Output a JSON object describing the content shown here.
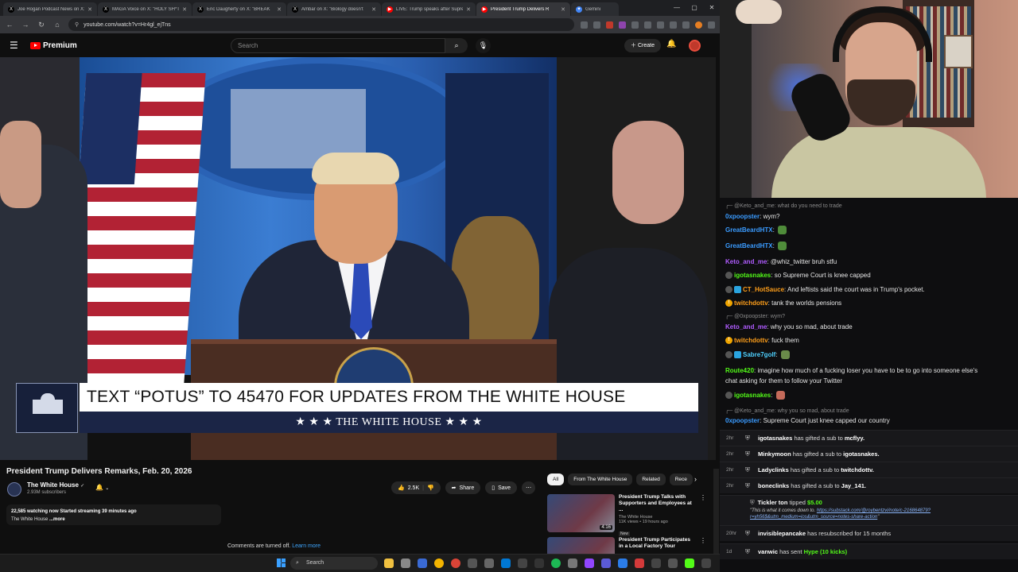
{
  "browser": {
    "tabs": [
      {
        "title": "Joe Rogan Podcast News on X:",
        "color": "#000000",
        "glyph": "X"
      },
      {
        "title": "MAGA Voice on X: \"HOLY SH*T",
        "color": "#000000",
        "glyph": "X"
      },
      {
        "title": "Eric Daugherty on X: \"BREAK",
        "color": "#000000",
        "glyph": "X"
      },
      {
        "title": "Ambar on X: \"Biology doesn't",
        "color": "#000000",
        "glyph": "X"
      },
      {
        "title": "LIVE: Trump speaks after Supre",
        "color": "#ff0000",
        "glyph": "▶"
      },
      {
        "title": "President Trump Delivers R",
        "color": "#ff0000",
        "glyph": "▶",
        "active": true
      },
      {
        "title": "Gemini",
        "color": "#4285f4",
        "glyph": "✦"
      }
    ],
    "url": "youtube.com/watch?v=Hr4gl_ejTns"
  },
  "youtube": {
    "logo_text": "Premium",
    "search_placeholder": "Search",
    "create_label": "Create",
    "video": {
      "banner_text": "TEXT “POTUS” TO 45470 FOR UPDATES FROM THE WHITE HOUSE",
      "banner_sub": "★ ★ ★  THE WHITE HOUSE  ★ ★ ★"
    },
    "title": "President Trump Delivers Remarks, Feb. 20, 2026",
    "channel": {
      "name": "The White House",
      "verified": "✓",
      "subscribers": "2.93M subscribers"
    },
    "actions": {
      "likes": "2.5K",
      "share": "Share",
      "save": "Save"
    },
    "description": {
      "line1": "22,585 watching now  Started streaming 39 minutes ago",
      "line2": "The White House",
      "more": "...more"
    },
    "comments_off": "Comments are turned off.",
    "learn_more": "Learn more",
    "chips": [
      "All",
      "From The White House",
      "Related",
      "Rece"
    ],
    "recommendations": [
      {
        "title": "President Trump Talks with Supporters and Employees at ...",
        "channel": "The White House",
        "views": "11K views • 19 hours ago",
        "badge": "New",
        "duration": "4:16"
      },
      {
        "title": "President Trump Participates in a Local Factory Tour",
        "channel": "",
        "views": "",
        "badge": "",
        "duration": ""
      }
    ]
  },
  "taskbar": {
    "search_label": "Search"
  },
  "chat": {
    "messages": [
      {
        "type": "reply",
        "text": "@Keto_and_me: what do you need to trade"
      },
      {
        "user": "0xpoopster",
        "color": "#3a9bff",
        "text": "wym?"
      },
      {
        "user": "GreatBeardHTX",
        "color": "#3a9bff",
        "text": "",
        "emote": "#4f8c3a"
      },
      {
        "user": "GreatBeardHTX",
        "color": "#3a9bff",
        "text": "",
        "emote": "#4f8c3a"
      },
      {
        "user": "Keto_and_me",
        "color": "#b05cff",
        "text": "@whiz_twitter bruh stfu"
      },
      {
        "user": "igotasnakes",
        "color": "#53fc18",
        "text": "so Supreme Court is knee capped",
        "badge": "#555"
      },
      {
        "user": "CT_HotSauce",
        "color": "#ff9f1a",
        "text": "And leftists said the court was in Trump's pocket.",
        "badge": "#555",
        "badge2": "#2aa4e0"
      },
      {
        "user": "twitchdottv",
        "color": "#ff9f1a",
        "text": "tank the worlds pensions",
        "badge": "#f0a500",
        "badgeGlyph": "!"
      },
      {
        "type": "reply",
        "text": "@0xpoopster: wym?"
      },
      {
        "user": "Keto_and_me",
        "color": "#b05cff",
        "text": "why you so mad, about trade"
      },
      {
        "user": "twitchdottv",
        "color": "#ff9f1a",
        "text": "fuck them",
        "badge": "#f0a500",
        "badgeGlyph": "!"
      },
      {
        "user": "Sabre7golf",
        "color": "#4fd1ff",
        "text": "",
        "badge": "#555",
        "badge2": "#2aa4e0",
        "emote": "#6a8a4a"
      },
      {
        "user": "Route420",
        "color": "#53fc18",
        "text": "imagine how much of a fucking loser you have to be to go into someone else's"
      },
      {
        "type": "cont",
        "text": "chat asking for them to follow your Twitter"
      },
      {
        "user": "igotasnakes",
        "color": "#53fc18",
        "text": "",
        "badge": "#555",
        "emote": "#c46a5a"
      },
      {
        "type": "reply",
        "text": "@Keto_and_me: why you so mad, about trade"
      },
      {
        "user": "0xpoopster",
        "color": "#3a9bff",
        "text": "Supreme Court just knee capped our country"
      }
    ],
    "events": [
      {
        "ago": "2hr",
        "user": "igotasnakes",
        "text": "has gifted a sub to",
        "target": "mcflyy."
      },
      {
        "ago": "2hr",
        "user": "Minkymoon",
        "text": "has gifted a sub to",
        "target": "igotasnakes."
      },
      {
        "ago": "2hr",
        "user": "Ladyclinks",
        "text": "has gifted a sub to",
        "target": "twitchdottv."
      },
      {
        "ago": "2hr",
        "user": "boneclinks",
        "text": "has gifted a sub to",
        "target": "Jay_141."
      }
    ],
    "tip": {
      "user": "Tickler ton",
      "action": "tipped",
      "amount": "$5.00",
      "message": "\"This is what it comes down to.",
      "link": "https://substack.com/@roybentzvi/note/c-216864879?r=yh56$&utm_medium=ios&utm_source=notes-share-action",
      "close": "\""
    },
    "events2": [
      {
        "ago": "20hr",
        "user": "invisiblepancake",
        "text": "has resubscribed for 15 months",
        "target": ""
      },
      {
        "ago": "1d",
        "user": "vanwic",
        "text": "has sent",
        "target": "",
        "hype": "Hype (10 kicks)"
      }
    ]
  }
}
